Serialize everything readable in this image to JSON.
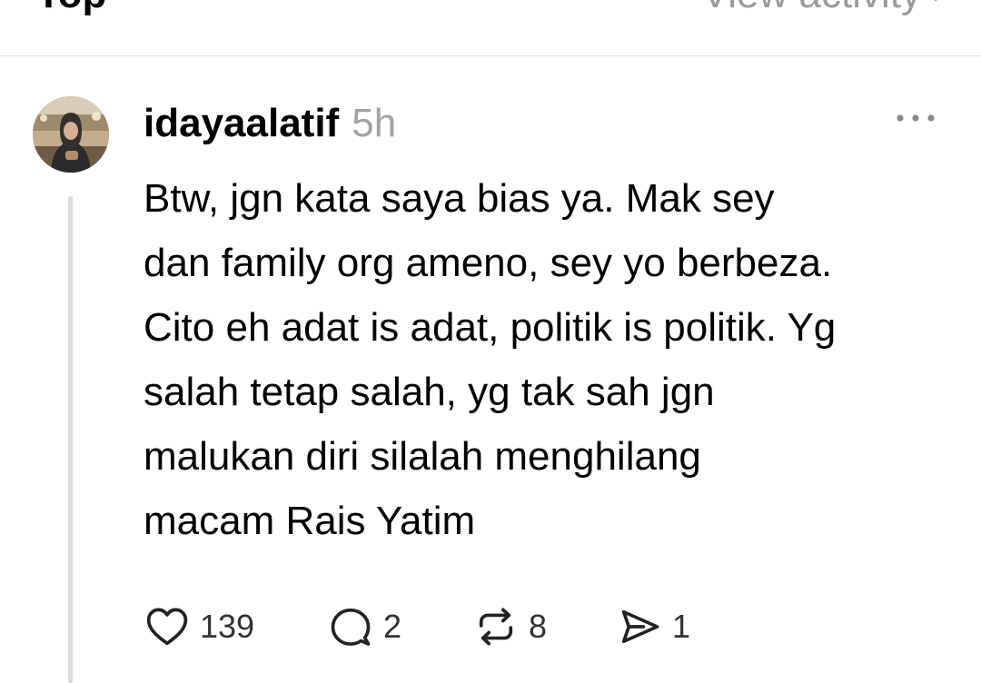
{
  "top_bar": {
    "sort_label": "Top",
    "view_activity_label": "View activity"
  },
  "post": {
    "username": "idayaalatif",
    "timestamp": "5h",
    "body": "Btw, jgn kata saya bias ya. Mak sey\ndan family org ameno, sey yo berbeza.\nCito eh adat is adat, politik is politik. Yg\nsalah tetap salah, yg tak sah jgn\nmalukan diri silalah menghilang\nmacam Rais Yatim",
    "likes": "139",
    "replies": "2",
    "reposts": "8",
    "shares": "1"
  },
  "icons": {
    "like": "heart-icon",
    "reply": "comment-bubble-icon",
    "repost": "repost-arrows-icon",
    "share": "send-icon",
    "more": "more-horizontal-icon"
  },
  "colors": {
    "text": "#000000",
    "muted": "#a3a3a3",
    "divider": "#e2e2e2",
    "thread_line": "#dadada"
  }
}
